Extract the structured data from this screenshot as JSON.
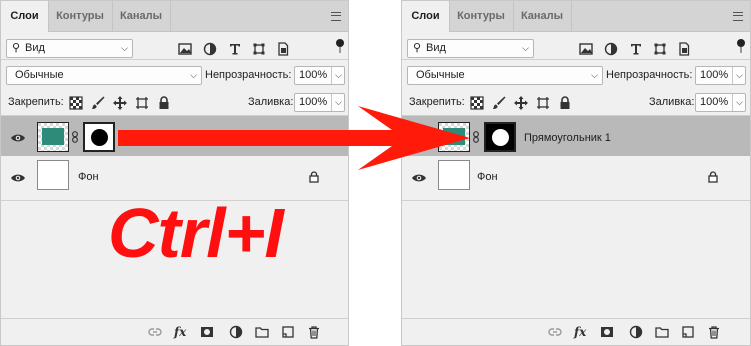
{
  "colors": {
    "accent_red": "#ff1a0a",
    "selected_row": "#b9b9b9",
    "teal": "#2e8b7a"
  },
  "overlay": {
    "shortcut_text": "Ctrl+I"
  },
  "left": {
    "tabs": [
      "Слои",
      "Контуры",
      "Каналы"
    ],
    "filter_value": "Вид",
    "blend_mode": "Обычные",
    "opacity_label": "Непрозрачность:",
    "opacity_value": "100%",
    "lock_label": "Закрепить:",
    "fill_label": "Заливка:",
    "fill_value": "100%",
    "layers": [
      {
        "name": "",
        "selected": true,
        "has_mask": true
      },
      {
        "name": "Фон",
        "selected": false,
        "locked": true
      }
    ],
    "footer_icons": [
      "link-icon",
      "fx-icon",
      "mask-icon",
      "adjustment-icon",
      "folder-icon",
      "new-layer-icon",
      "trash-icon"
    ]
  },
  "right": {
    "tabs": [
      "Слои",
      "Контуры",
      "Каналы"
    ],
    "filter_value": "Вид",
    "blend_mode": "Обычные",
    "opacity_label": "Непрозрачность:",
    "opacity_value": "100%",
    "lock_label": "Закрепить:",
    "fill_label": "Заливка:",
    "fill_value": "100%",
    "layers": [
      {
        "name": "Прямоугольник 1",
        "selected": true,
        "has_mask": true
      },
      {
        "name": "Фон",
        "selected": false,
        "locked": true
      }
    ],
    "footer_icons": [
      "link-icon",
      "fx-icon",
      "mask-icon",
      "adjustment-icon",
      "folder-icon",
      "new-layer-icon",
      "trash-icon"
    ]
  }
}
